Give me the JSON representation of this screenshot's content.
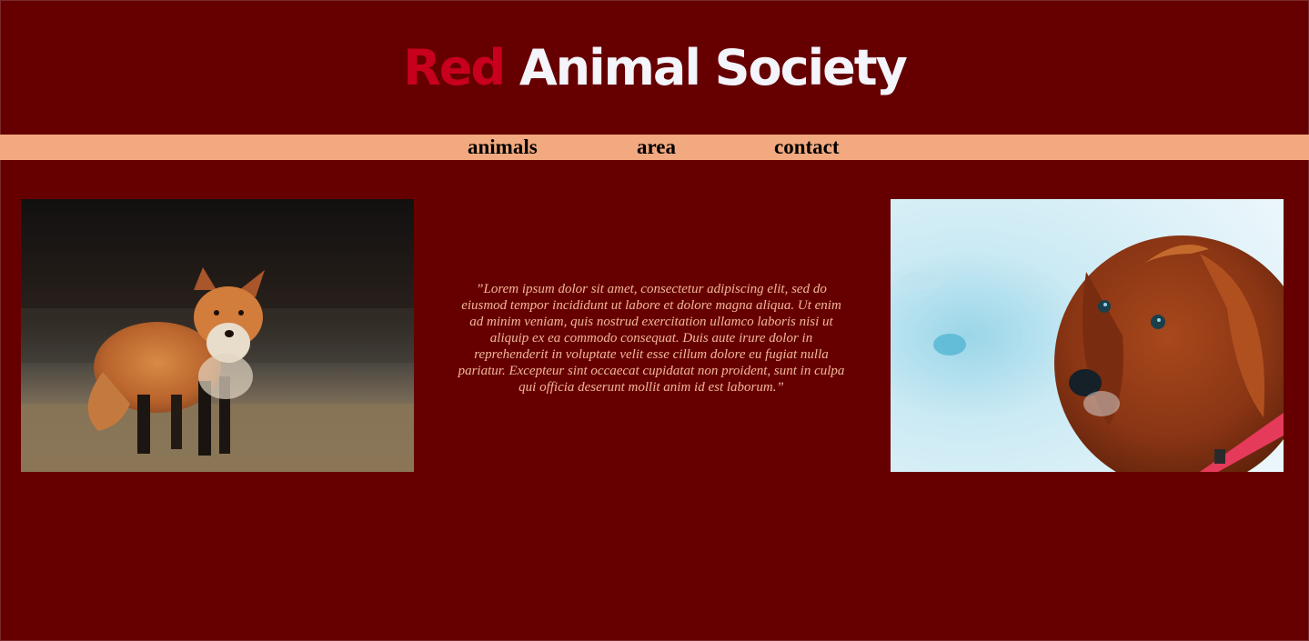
{
  "header": {
    "title_accent": "Red",
    "title_rest": "Animal Society",
    "accent_color": "#c8001e",
    "text_color": "#f4f4fb"
  },
  "nav": {
    "items": [
      {
        "label": "animals"
      },
      {
        "label": "area"
      },
      {
        "label": "contact"
      }
    ],
    "background": "#f2a97f"
  },
  "main": {
    "quote": "”Lorem ipsum dolor sit amet, consectetur adipiscing elit, sed do eiusmod tempor incididunt ut labore et dolore magna aliqua. Ut enim ad minim veniam, quis nostrud exercitation ullamco laboris nisi ut aliquip ex ea commodo consequat. Duis aute irure dolor in reprehenderit in voluptate velit esse cillum dolore eu fugiat nulla pariatur. Excepteur sint occaecat cupidatat non proident, sunt in culpa qui officia deserunt mollit anim id est laborum.”",
    "images": [
      {
        "name": "fox-photo"
      },
      {
        "name": "dog-photo"
      }
    ]
  },
  "colors": {
    "page_background": "#660000",
    "quote_text": "#f2b79a"
  }
}
